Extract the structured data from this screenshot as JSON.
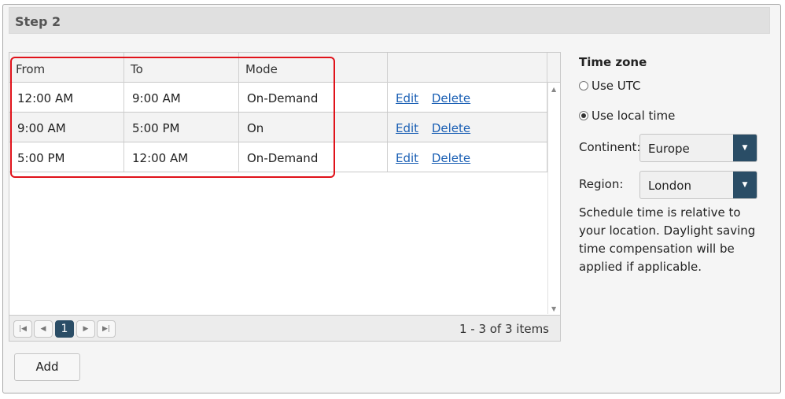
{
  "step": {
    "title": "Step 2"
  },
  "grid": {
    "columns": [
      "From",
      "To",
      "Mode",
      ""
    ],
    "rows": [
      {
        "from": "12:00 AM",
        "to": "9:00 AM",
        "mode": "On-Demand",
        "edit": "Edit",
        "delete": "Delete"
      },
      {
        "from": "9:00 AM",
        "to": "5:00 PM",
        "mode": "On",
        "edit": "Edit",
        "delete": "Delete"
      },
      {
        "from": "5:00 PM",
        "to": "12:00 AM",
        "mode": "On-Demand",
        "edit": "Edit",
        "delete": "Delete"
      }
    ],
    "pager": {
      "current_page": "1",
      "info": "1 - 3 of 3 items"
    }
  },
  "add_button": "Add",
  "timezone": {
    "title": "Time zone",
    "use_utc": "Use UTC",
    "use_local": "Use local time",
    "selected": "Use local time",
    "continent_label": "Continent:",
    "continent_value": "Europe",
    "region_label": "Region:",
    "region_value": "London",
    "note": "Schedule time is relative to your location. Daylight saving time compensation will be applied if applicable."
  },
  "colors": {
    "accent": "#2a4d66",
    "highlight": "#e0121a",
    "link": "#1a5fb4"
  }
}
